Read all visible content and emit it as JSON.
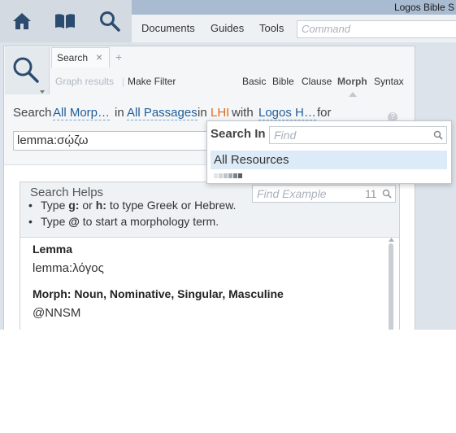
{
  "app": {
    "title": "Logos Bible S"
  },
  "menus": [
    "Documents",
    "Guides",
    "Tools"
  ],
  "command": {
    "placeholder": "Command"
  },
  "tab": {
    "label": "Search",
    "close": "×",
    "add": "+"
  },
  "subtoolbar": {
    "graph_results": "Graph results",
    "make_filter": "Make Filter",
    "types": [
      "Basic",
      "Bible",
      "Clause",
      "Morph",
      "Syntax"
    ],
    "active_type": "Morph"
  },
  "query": {
    "search": "Search",
    "morph_link": "All Morp…",
    "in1": "in",
    "passages_link": "All Passages",
    "in2": "in",
    "lhi": "LHI",
    "with": "with",
    "logos_link": "Logos H…",
    "for": "for",
    "help": "?",
    "value": "lemma:σῴζω"
  },
  "search_helps": {
    "title": "Search Helps",
    "find_placeholder": "Find Example",
    "count": "11",
    "tip1": [
      "Type",
      "g:",
      "or",
      "h:",
      "to type Greek or Hebrew."
    ],
    "tip2": [
      "Type",
      "@",
      "to start a morphology term."
    ],
    "examples": [
      {
        "label": "Lemma",
        "value": "lemma:λόγος"
      },
      {
        "label": "Morph: Noun, Nominative, Singular, Masculine",
        "value": "@NNSM"
      }
    ]
  },
  "search_in": {
    "label": "Search In",
    "find_placeholder": "Find",
    "item": "All Resources"
  },
  "colors": {
    "accent": "#1e5d9a",
    "lhi": "#e06a1f",
    "highlight": "#dcebf7"
  }
}
